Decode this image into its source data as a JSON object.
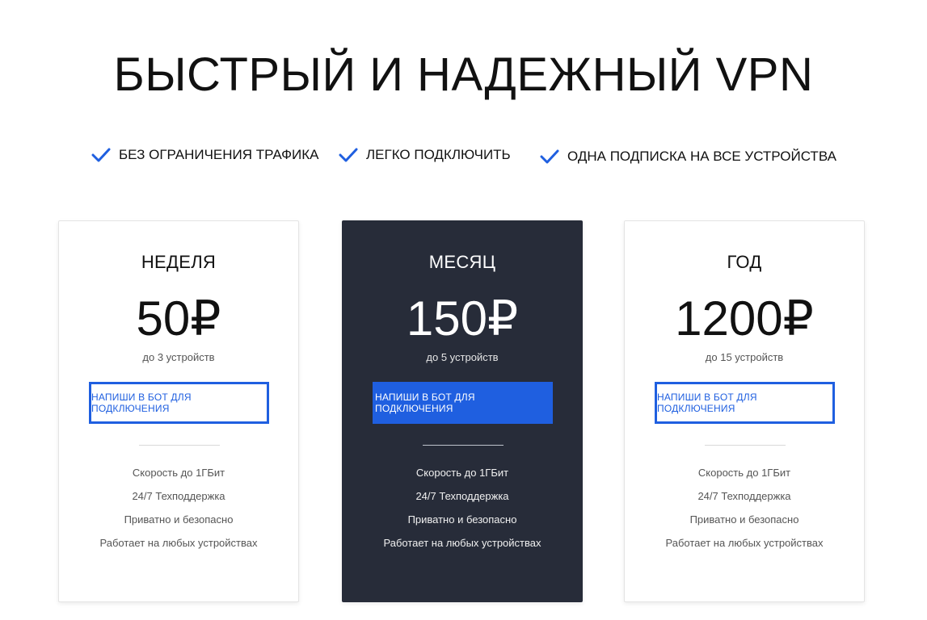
{
  "page": {
    "title": "БЫСТРЫЙ И НАДЕЖНЫЙ VPN"
  },
  "colors": {
    "accent": "#1f5fe0",
    "dark_card": "#272c39",
    "check": "#1f5fe0"
  },
  "features": [
    {
      "label": "БЕЗ ОГРАНИЧЕНИЯ ТРАФИКА",
      "icon": "check-icon"
    },
    {
      "label": "ЛЕГКО ПОДКЛЮЧИТЬ",
      "icon": "check-icon"
    },
    {
      "label": "ОДНА ПОДПИСКА НА ВСЕ УСТРОЙСТВА",
      "icon": "check-icon"
    }
  ],
  "plans": [
    {
      "name": "НЕДЕЛЯ",
      "price": "50₽",
      "devices": "до 3 устройств",
      "cta": "НАПИШИ В БОТ ДЛЯ ПОДКЛЮЧЕНИЯ",
      "features": [
        "Скорость до 1ГБит",
        "24/7 Техподдержка",
        "Приватно и безопасно",
        "Работает на любых устройствах"
      ]
    },
    {
      "name": "МЕСЯЦ",
      "price": "150₽",
      "devices": "до 5 устройств",
      "cta": "НАПИШИ В БОТ ДЛЯ ПОДКЛЮЧЕНИЯ",
      "features": [
        "Скорость до 1ГБит",
        "24/7 Техподдержка",
        "Приватно и безопасно",
        "Работает на любых устройствах"
      ]
    },
    {
      "name": "ГОД",
      "price": "1200₽",
      "devices": "до 15 устройств",
      "cta": "НАПИШИ В БОТ ДЛЯ ПОДКЛЮЧЕНИЯ",
      "features": [
        "Скорость до 1ГБит",
        "24/7 Техподдержка",
        "Приватно и безопасно",
        "Работает на любых устройствах"
      ]
    }
  ]
}
